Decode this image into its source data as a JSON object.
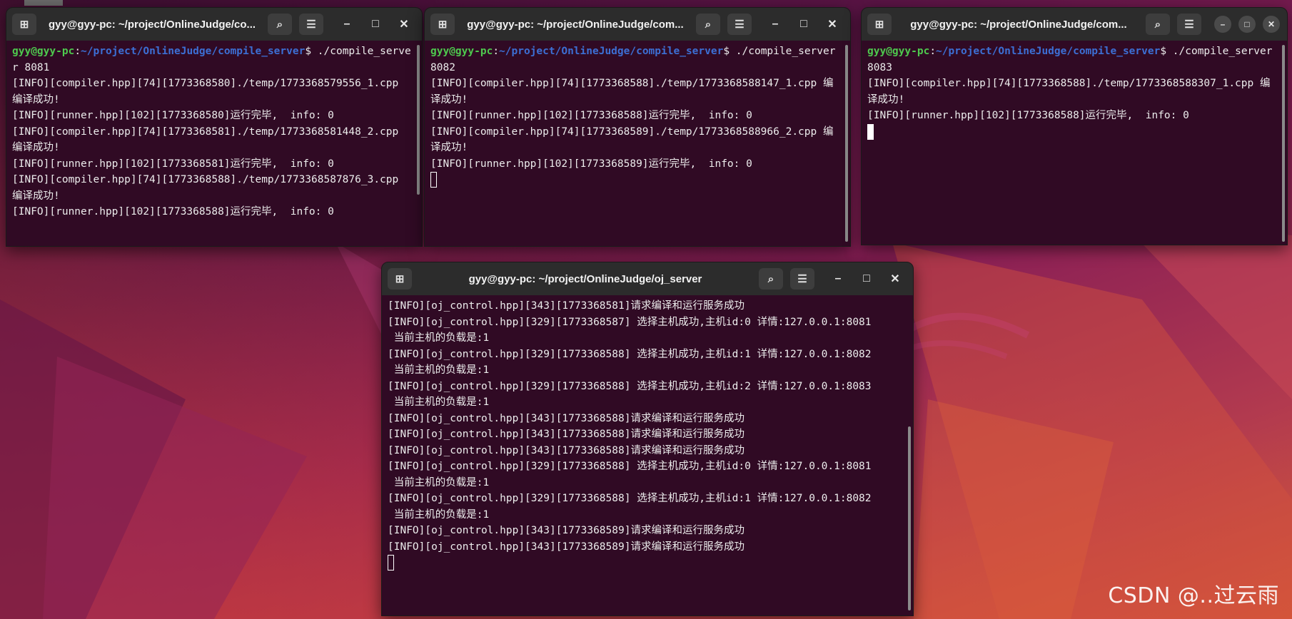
{
  "colors": {
    "terminal_bg": "#300a24",
    "titlebar_bg": "#2c2c2c",
    "user_host": "#4ec94e",
    "path": "#3c6fd4",
    "text": "#ececec"
  },
  "window1": {
    "title": "gyy@gyy-pc: ~/project/OnlineJudge/co...",
    "prompt": {
      "user_host": "gyy@gyy-pc",
      "path": "~/project/OnlineJudge/compile_server",
      "command": "$ ./compile_server 8081"
    },
    "lines": [
      "[INFO][compiler.hpp][74][1773368580]./temp/1773368579556_1.cpp 编译成功!",
      "[INFO][runner.hpp][102][1773368580]运行完毕,  info: 0",
      "[INFO][compiler.hpp][74][1773368581]./temp/1773368581448_2.cpp 编译成功!",
      "[INFO][runner.hpp][102][1773368581]运行完毕,  info: 0",
      "[INFO][compiler.hpp][74][1773368588]./temp/1773368587876_3.cpp 编译成功!",
      "[INFO][runner.hpp][102][1773368588]运行完毕,  info: 0"
    ]
  },
  "window2": {
    "title": "gyy@gyy-pc: ~/project/OnlineJudge/com...",
    "prompt": {
      "user_host": "gyy@gyy-pc",
      "path": "~/project/OnlineJudge/compile_server",
      "command": "$ ./compile_server 8082"
    },
    "lines": [
      "[INFO][compiler.hpp][74][1773368588]./temp/1773368588147_1.cpp 编译成功!",
      "[INFO][runner.hpp][102][1773368588]运行完毕,  info: 0",
      "[INFO][compiler.hpp][74][1773368589]./temp/1773368588966_2.cpp 编译成功!",
      "[INFO][runner.hpp][102][1773368589]运行完毕,  info: 0"
    ]
  },
  "window3": {
    "title": "gyy@gyy-pc: ~/project/OnlineJudge/com...",
    "prompt": {
      "user_host": "gyy@gyy-pc",
      "path": "~/project/OnlineJudge/compile_server",
      "command": "$ ./compile_server 8083"
    },
    "lines": [
      "[INFO][compiler.hpp][74][1773368588]./temp/1773368588307_1.cpp 编译成功!",
      "[INFO][runner.hpp][102][1773368588]运行完毕,  info: 0"
    ]
  },
  "window4": {
    "title": "gyy@gyy-pc: ~/project/OnlineJudge/oj_server",
    "lines": [
      "[INFO][oj_control.hpp][343][1773368581]请求编译和运行服务成功",
      "[INFO][oj_control.hpp][329][1773368587] 选择主机成功,主机id:0 详情:127.0.0.1:8081",
      " 当前主机的负载是:1",
      "[INFO][oj_control.hpp][329][1773368588] 选择主机成功,主机id:1 详情:127.0.0.1:8082",
      " 当前主机的负载是:1",
      "[INFO][oj_control.hpp][329][1773368588] 选择主机成功,主机id:2 详情:127.0.0.1:8083",
      " 当前主机的负载是:1",
      "[INFO][oj_control.hpp][343][1773368588]请求编译和运行服务成功",
      "[INFO][oj_control.hpp][343][1773368588]请求编译和运行服务成功",
      "[INFO][oj_control.hpp][343][1773368588]请求编译和运行服务成功",
      "[INFO][oj_control.hpp][329][1773368588] 选择主机成功,主机id:0 详情:127.0.0.1:8081",
      " 当前主机的负载是:1",
      "[INFO][oj_control.hpp][329][1773368588] 选择主机成功,主机id:1 详情:127.0.0.1:8082",
      " 当前主机的负载是:1",
      "[INFO][oj_control.hpp][343][1773368589]请求编译和运行服务成功",
      "[INFO][oj_control.hpp][343][1773368589]请求编译和运行服务成功"
    ]
  },
  "watermark": "CSDN @..过云雨"
}
